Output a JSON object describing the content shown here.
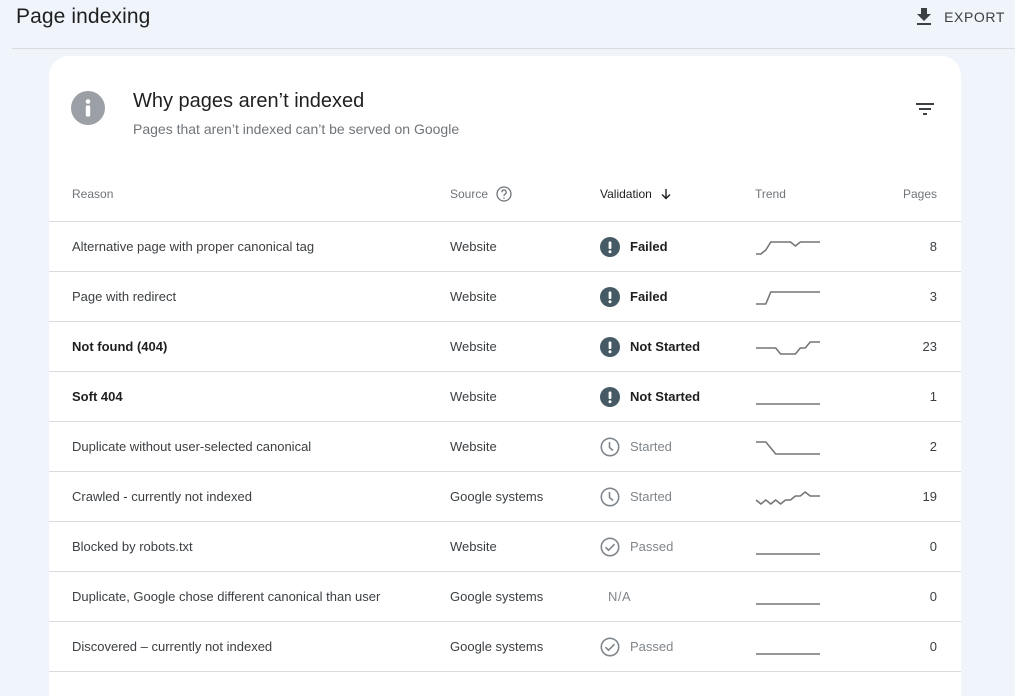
{
  "header": {
    "title": "Page indexing",
    "export_label": "EXPORT",
    "export_icon": "download-icon"
  },
  "card": {
    "icon": "info-icon",
    "title": "Why pages aren’t indexed",
    "subtitle": "Pages that aren’t indexed can’t be served on Google",
    "filter_icon": "filter-icon"
  },
  "table": {
    "columns": {
      "reason": "Reason",
      "source": "Source",
      "validation": "Validation",
      "trend": "Trend",
      "pages": "Pages"
    },
    "sort": {
      "column": "validation",
      "direction": "descending"
    },
    "rows": [
      {
        "reason": "Alternative page with proper canonical tag",
        "bold": false,
        "source": "Website",
        "validation": "Failed",
        "validation_icon": "alert-icon",
        "trend": [
          2,
          2,
          3,
          5,
          5,
          5,
          5,
          5,
          4,
          5,
          5,
          5,
          5,
          5
        ],
        "pages": "8"
      },
      {
        "reason": "Page with redirect",
        "bold": false,
        "source": "Website",
        "validation": "Failed",
        "validation_icon": "alert-icon",
        "trend": [
          1,
          1,
          1,
          2,
          2,
          2,
          2,
          2,
          2,
          2,
          2,
          2,
          2,
          2
        ],
        "pages": "3"
      },
      {
        "reason": "Not found (404)",
        "bold": true,
        "source": "Website",
        "validation": "Not Started",
        "validation_icon": "alert-icon",
        "trend": [
          22,
          22,
          22,
          22,
          22,
          21,
          21,
          21,
          21,
          22,
          22,
          23,
          23,
          23
        ],
        "pages": "23"
      },
      {
        "reason": "Soft 404",
        "bold": true,
        "source": "Website",
        "validation": "Not Started",
        "validation_icon": "alert-icon",
        "trend": [
          1,
          1,
          1,
          1,
          1,
          1,
          1,
          1,
          1,
          1,
          1,
          1,
          1,
          1
        ],
        "pages": "1"
      },
      {
        "reason": "Duplicate without user-selected canonical",
        "bold": false,
        "source": "Website",
        "validation": "Started",
        "validation_icon": "clock-icon",
        "trend": [
          4,
          4,
          4,
          3,
          2,
          2,
          2,
          2,
          2,
          2,
          2,
          2,
          2,
          2
        ],
        "pages": "2"
      },
      {
        "reason": "Crawled - currently not indexed",
        "bold": false,
        "source": "Google systems",
        "validation": "Started",
        "validation_icon": "clock-icon",
        "trend": [
          18,
          17,
          18,
          17,
          18,
          17,
          18,
          18,
          19,
          19,
          20,
          19,
          19,
          19
        ],
        "pages": "19"
      },
      {
        "reason": "Blocked by robots.txt",
        "bold": false,
        "source": "Website",
        "validation": "Passed",
        "validation_icon": "check-circle-icon",
        "trend": [
          0,
          0,
          0,
          0,
          0,
          0,
          0,
          0,
          0,
          0,
          0,
          0,
          0,
          0
        ],
        "pages": "0"
      },
      {
        "reason": "Duplicate, Google chose different canonical than user",
        "bold": false,
        "source": "Google systems",
        "validation": "N/A",
        "validation_icon": "",
        "trend": [
          0,
          0,
          0,
          0,
          0,
          0,
          0,
          0,
          0,
          0,
          0,
          0,
          0,
          0
        ],
        "pages": "0"
      },
      {
        "reason": "Discovered – currently not indexed",
        "bold": false,
        "source": "Google systems",
        "validation": "Passed",
        "validation_icon": "check-circle-icon",
        "trend": [
          0,
          0,
          0,
          0,
          0,
          0,
          0,
          0,
          0,
          0,
          0,
          0,
          0,
          0
        ],
        "pages": "0"
      }
    ]
  }
}
